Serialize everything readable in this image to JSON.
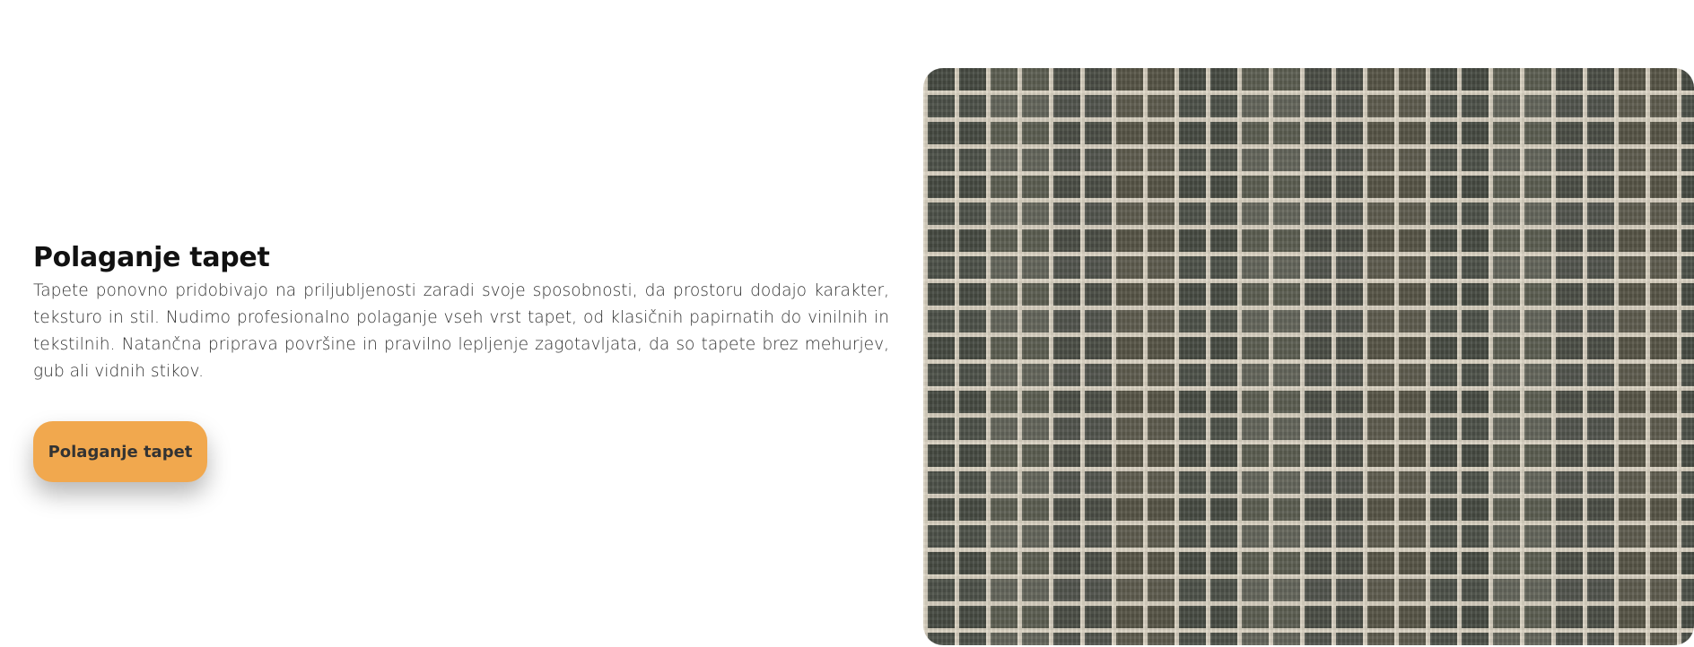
{
  "section": {
    "title": "Polaganje tapet",
    "description": "Tapete ponovno pridobivajo na priljubljenosti zaradi svoje sposobnosti, da prostoru dodajo karakter, teksturo in stil. Nudimo profesionalno polaganje vseh vrst tapet, od klasičnih papirnatih do vinilnih in tekstilnih. Natančna priprava površine in pravilno lepljenje zagotavljata, da so tapete brez mehurjev, gub ali vidnih stikov.",
    "button_label": "Polaganje tapet",
    "image_alt": "brick-wall-wallpaper-image"
  },
  "colors": {
    "button_bg": "#f1a84e",
    "button_text": "#333333",
    "title": "#111111",
    "body_text": "#333333",
    "background": "#ffffff"
  }
}
